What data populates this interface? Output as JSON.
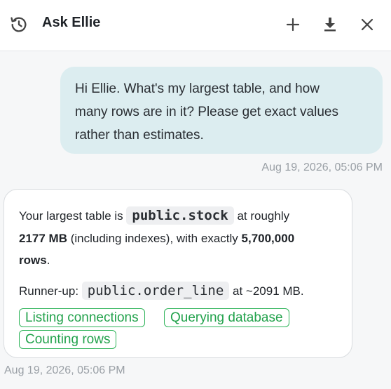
{
  "header": {
    "title": "Ask Ellie",
    "history_icon": "history-icon",
    "new_icon": "plus-icon",
    "download_icon": "download-icon",
    "close_icon": "close-icon"
  },
  "messages": {
    "user": {
      "lines": [
        "Hi Ellie. What's my largest table, and how",
        "many rows are in it? Please get exact values",
        "rather than estimates."
      ],
      "timestamp": "Aug 19, 2026, 05:06 PM"
    },
    "assistant": {
      "p1_a": "Your largest table is",
      "p1_code": "public.stock",
      "p1_b": "at roughly",
      "p1_size": "2177 MB",
      "p1_c": "(including indexes), with exactly",
      "p1_rows": "5,700,000",
      "p1_rows_word": "rows",
      "p1_end": ".",
      "p2_a": "Runner-up:",
      "p2_code": "public.order_line",
      "p2_b": "at ~2091 MB.",
      "tags": [
        "Listing connections",
        "Querying database",
        "Counting rows"
      ],
      "timestamp": "Aug 19, 2026, 05:06 PM"
    }
  },
  "colors": {
    "user_bubble": "#dcedf0",
    "tag_green": "#22a24c",
    "timestamp": "#9aa0a6"
  }
}
